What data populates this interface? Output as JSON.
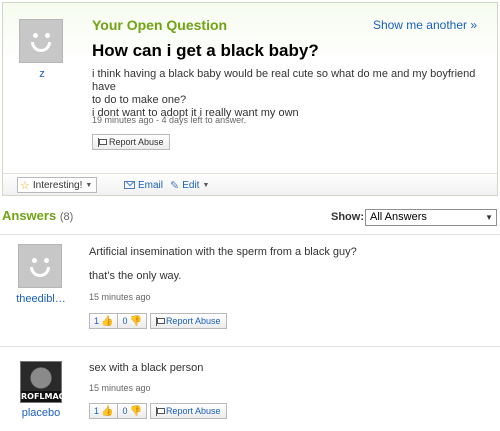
{
  "question": {
    "section_label": "Your Open Question",
    "show_another": "Show me another »",
    "asker": "z",
    "title": "How can i get a black baby?",
    "body_line1": "i think having a black baby would be real cute so what do me and my boyfriend have",
    "body_line2": "to do to make one?",
    "body_line3": "i dont want to adopt it i really want my own",
    "meta": "19 minutes ago - 4 days left to answer.",
    "report_label": "Report Abuse"
  },
  "actions": {
    "interesting": "Interesting!",
    "email": "Email",
    "edit": "Edit"
  },
  "answers_header": {
    "title": "Answers",
    "count": "(8)",
    "show_label": "Show:",
    "show_value": "All Answers"
  },
  "answers": [
    {
      "user": "theedibl…",
      "text1": "Artificial insemination with the sperm from a black guy?",
      "text2": "that's the only way.",
      "meta": "15 minutes ago",
      "up": "1",
      "down": "0",
      "report": "Report Abuse"
    },
    {
      "user": "placebo",
      "avatar_caption": "ROFLMAO",
      "text1": "sex with a black person",
      "meta": "15 minutes ago",
      "up": "1",
      "down": "0",
      "report": "Report Abuse"
    }
  ],
  "colors": {
    "accent_green": "#71a415",
    "link_blue": "#1a60ba"
  }
}
